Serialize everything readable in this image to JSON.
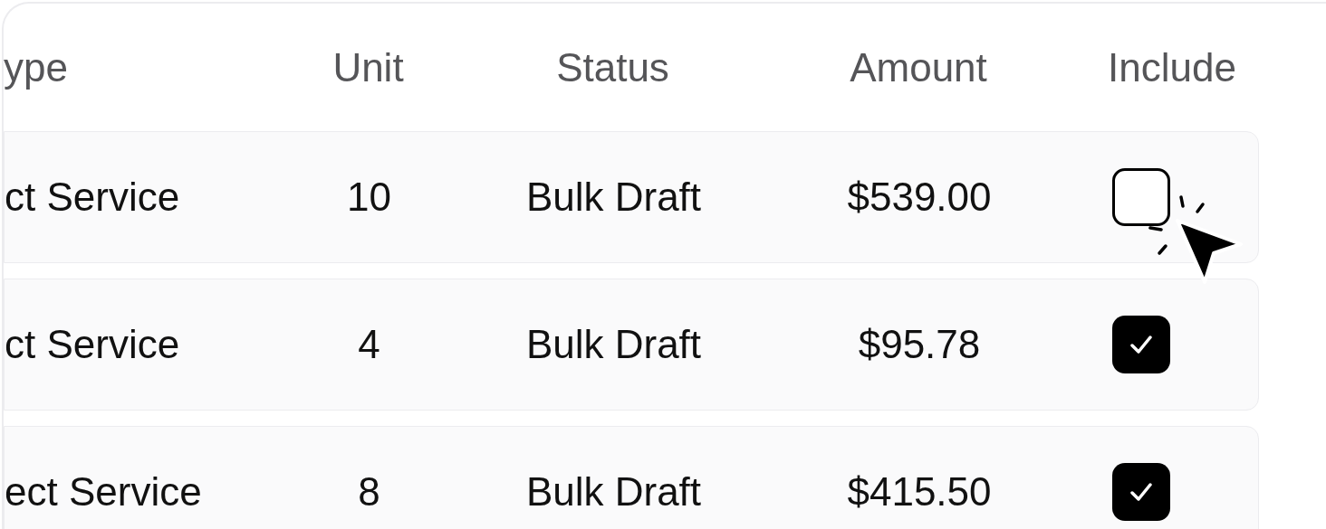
{
  "table": {
    "columns": [
      "ype",
      "Unit",
      "Status",
      "Amount",
      "Include"
    ],
    "rows": [
      {
        "type": "ct Service",
        "unit": "10",
        "status": "Bulk Draft",
        "amount": "$539.00",
        "checked": false
      },
      {
        "type": "ct Service",
        "unit": "4",
        "status": "Bulk Draft",
        "amount": "$95.78",
        "checked": true
      },
      {
        "type": "ect Service",
        "unit": "8",
        "status": "Bulk Draft",
        "amount": "$415.50",
        "checked": true
      }
    ]
  }
}
